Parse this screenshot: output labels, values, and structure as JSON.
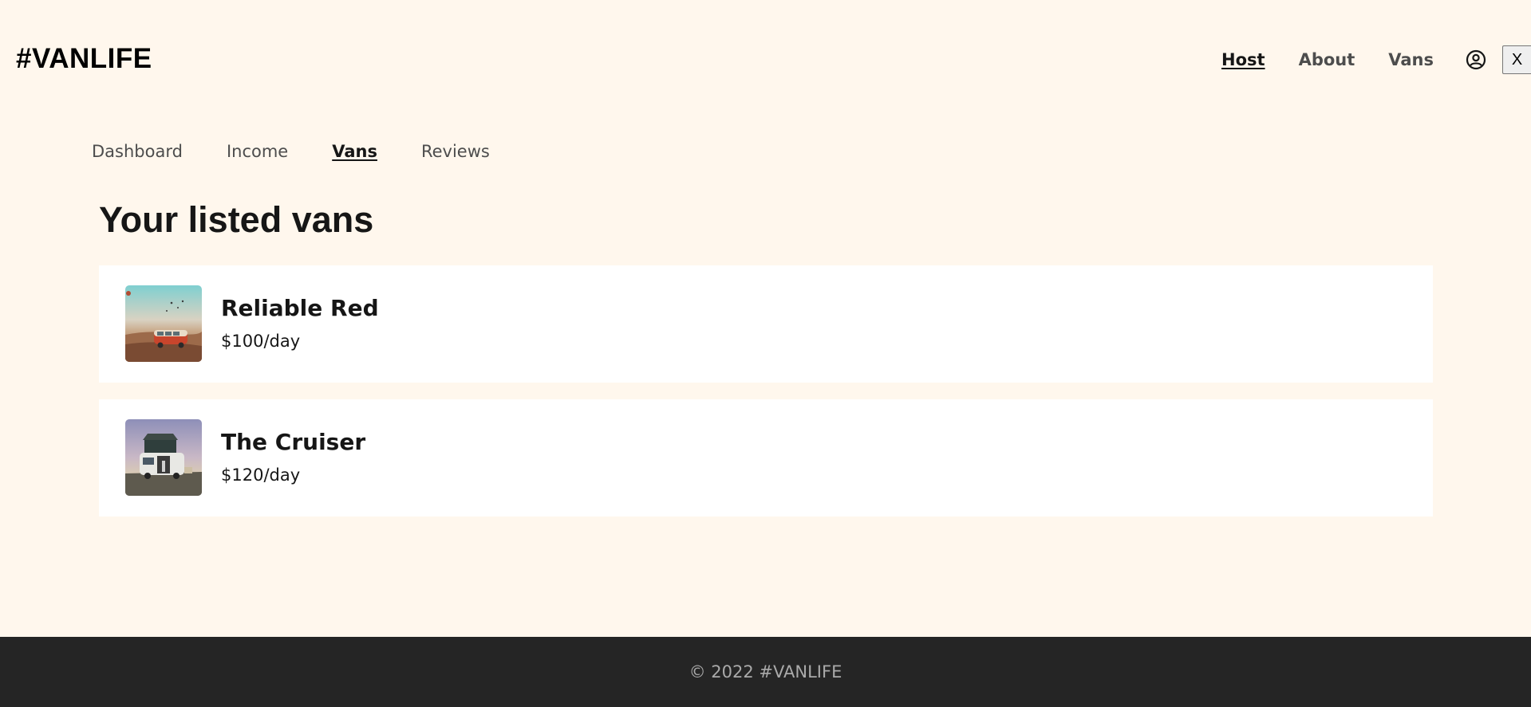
{
  "logo": "#VANLIFE",
  "top_nav": {
    "items": [
      {
        "label": "Host",
        "active": true
      },
      {
        "label": "About",
        "active": false
      },
      {
        "label": "Vans",
        "active": false
      }
    ],
    "login_icon": "user-circle-icon",
    "close_label": "X"
  },
  "host_nav": {
    "items": [
      {
        "label": "Dashboard",
        "active": false
      },
      {
        "label": "Income",
        "active": false
      },
      {
        "label": "Vans",
        "active": true
      },
      {
        "label": "Reviews",
        "active": false
      }
    ]
  },
  "main": {
    "title": "Your listed vans",
    "vans": [
      {
        "name": "Reliable Red",
        "price": "$100/day",
        "image": "red-van-desert-photo"
      },
      {
        "name": "The Cruiser",
        "price": "$120/day",
        "image": "white-van-rooftop-tent-photo"
      }
    ]
  },
  "footer": {
    "text": "© 2022 #VANLIFE"
  },
  "colors": {
    "background": "#FFF7ED",
    "card": "#FFFFFF",
    "footer": "#252525",
    "footer_text": "#AAAAAA",
    "text": "#161616",
    "muted_text": "#4D4D4D"
  }
}
